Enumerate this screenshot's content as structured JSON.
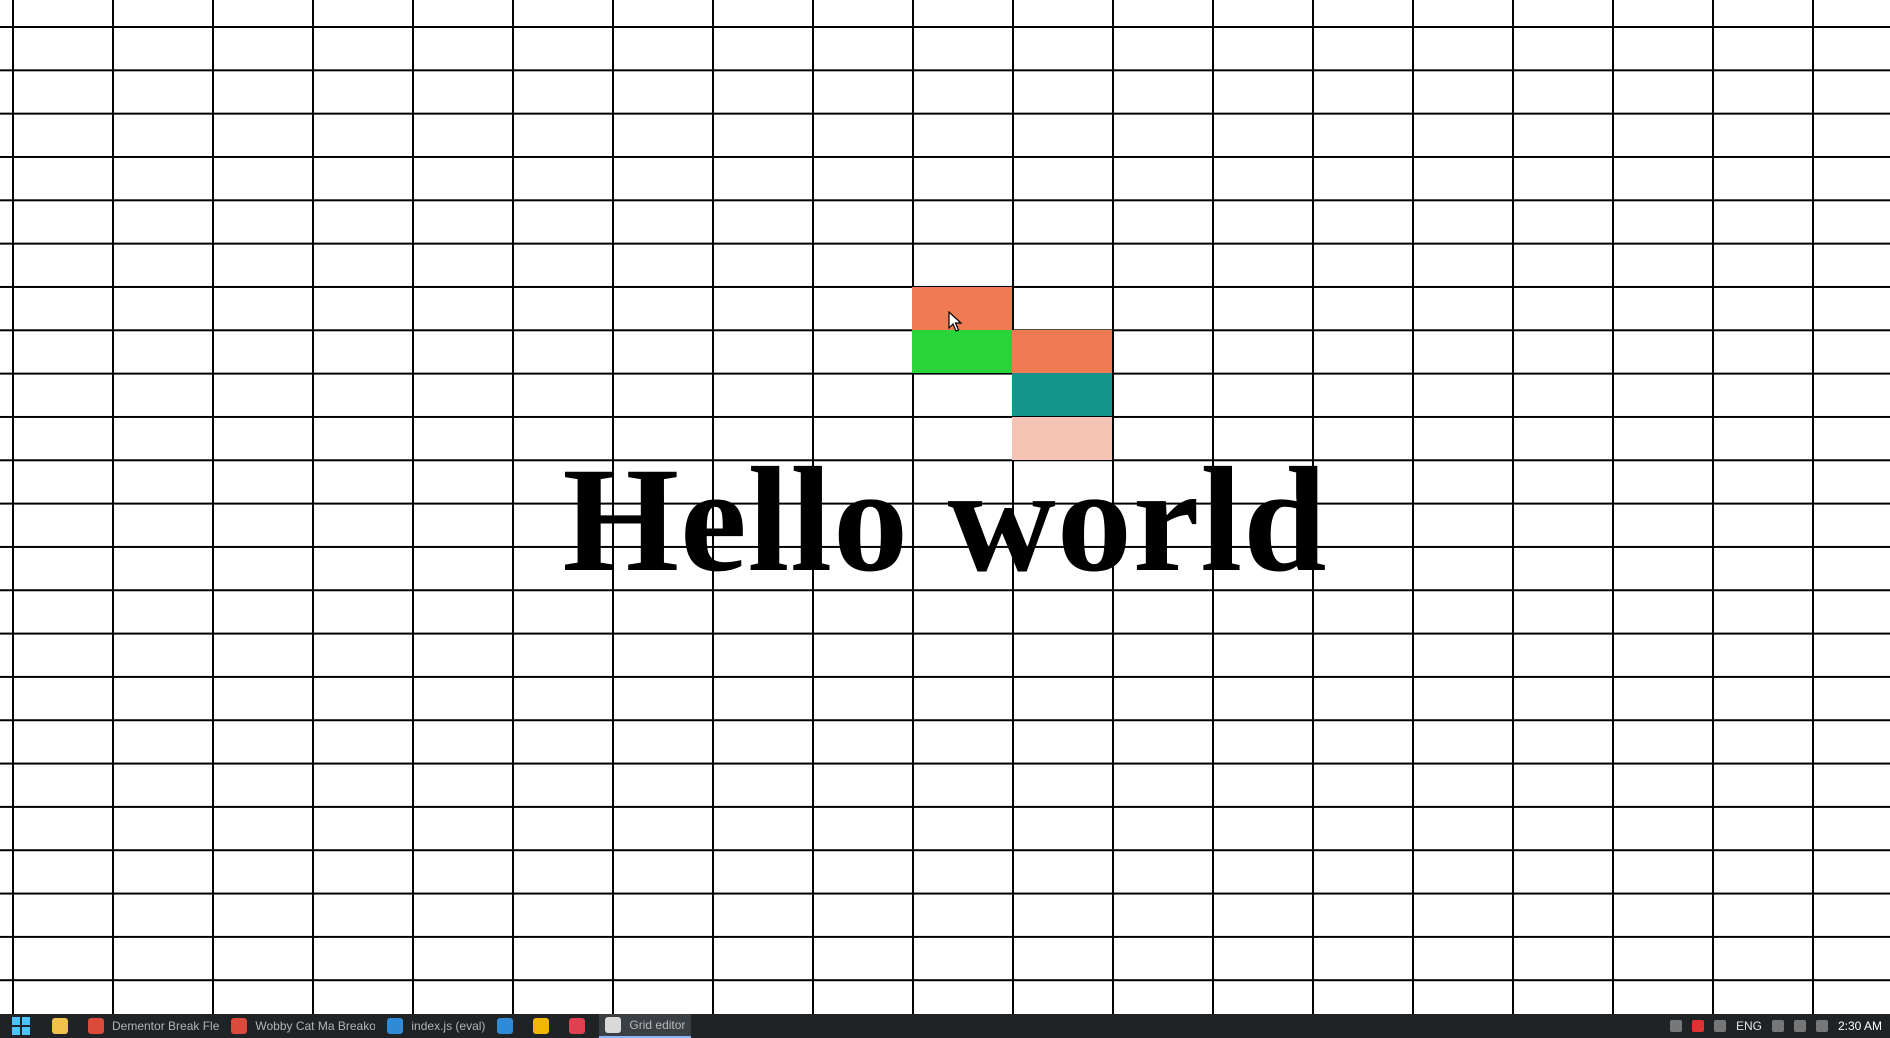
{
  "canvas": {
    "text": "Hello world",
    "cells": [
      {
        "name": "cell-a",
        "color": "#f07a52"
      },
      {
        "name": "cell-b",
        "color": "#28d43a"
      },
      {
        "name": "cell-c",
        "color": "#f07a52"
      },
      {
        "name": "cell-d",
        "color": "#15958a"
      },
      {
        "name": "cell-e",
        "color": "#f5c3b3"
      }
    ]
  },
  "taskbar": {
    "items": [
      {
        "label": "Dementor Break Fle",
        "icon": "chrome-icon",
        "color": "#dc4a3d"
      },
      {
        "label": "Wobby Cat Ma Breakout",
        "icon": "chrome-icon",
        "color": "#dc4a3d"
      },
      {
        "label": "index.js (eval)",
        "icon": "vscode-icon",
        "color": "#2f8ad8"
      },
      {
        "label": "",
        "icon": "vscode-icon",
        "color": "#2f8ad8"
      },
      {
        "label": "",
        "icon": "chrome-icon",
        "color": "#f2b705"
      },
      {
        "label": "",
        "icon": "pin-icon",
        "color": "#e04050"
      },
      {
        "label": "Grid editor",
        "icon": "app-icon",
        "color": "#d9d9d9"
      }
    ],
    "tray": {
      "lang": "ENG",
      "time": "2:30 AM"
    }
  }
}
